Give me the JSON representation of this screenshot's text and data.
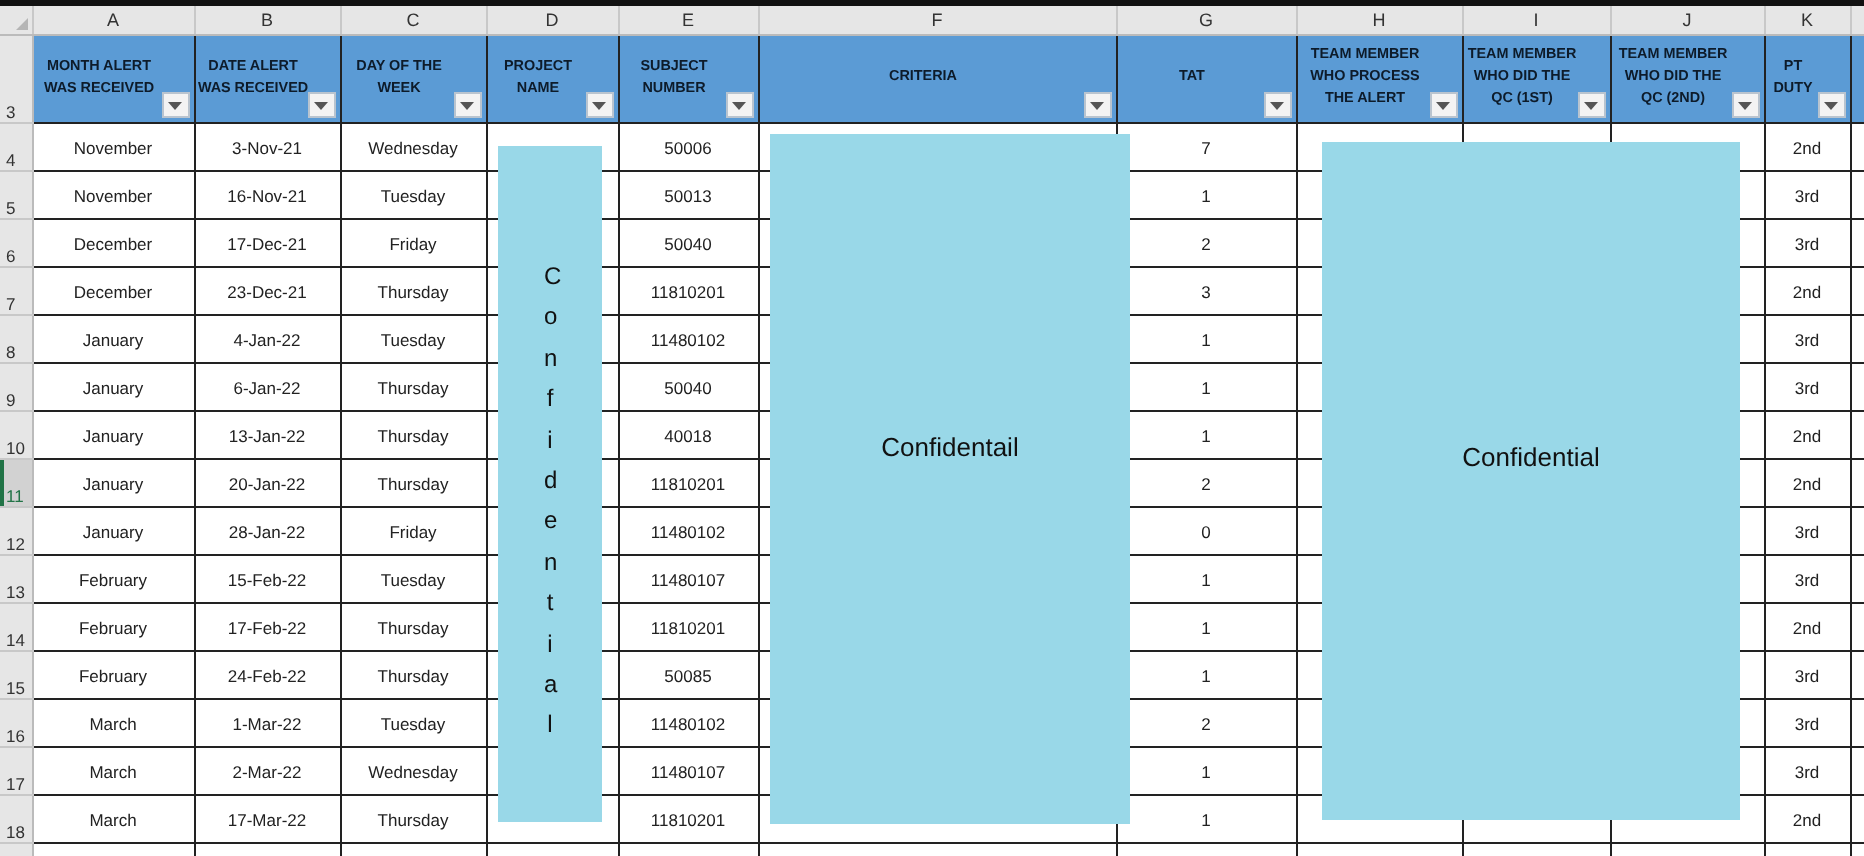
{
  "column_letters": [
    "A",
    "B",
    "C",
    "D",
    "E",
    "F",
    "G",
    "H",
    "I",
    "J",
    "K"
  ],
  "header_row": {
    "number": "3",
    "titles": [
      "MONTH ALERT WAS RECEIVED",
      "DATE ALERT WAS RECEIVED",
      "DAY OF THE WEEK",
      "PROJECT NAME",
      "SUBJECT NUMBER",
      "CRITERIA",
      "TAT",
      "TEAM MEMBER WHO PROCESS THE ALERT",
      "TEAM MEMBER WHO DID THE QC (1ST)",
      "TEAM MEMBER WHO DID THE QC (2ND)",
      "PT DUTY"
    ]
  },
  "rows": [
    {
      "number": "4",
      "month": "November",
      "date": "3-Nov-21",
      "day": "Wednesday",
      "subject": "50006",
      "tat": "7",
      "duty": "2nd",
      "selected": false
    },
    {
      "number": "5",
      "month": "November",
      "date": "16-Nov-21",
      "day": "Tuesday",
      "subject": "50013",
      "tat": "1",
      "duty": "3rd",
      "selected": false
    },
    {
      "number": "6",
      "month": "December",
      "date": "17-Dec-21",
      "day": "Friday",
      "subject": "50040",
      "tat": "2",
      "duty": "3rd",
      "selected": false
    },
    {
      "number": "7",
      "month": "December",
      "date": "23-Dec-21",
      "day": "Thursday",
      "subject": "11810201",
      "tat": "3",
      "duty": "2nd",
      "selected": false
    },
    {
      "number": "8",
      "month": "January",
      "date": "4-Jan-22",
      "day": "Tuesday",
      "subject": "11480102",
      "tat": "1",
      "duty": "3rd",
      "selected": false
    },
    {
      "number": "9",
      "month": "January",
      "date": "6-Jan-22",
      "day": "Thursday",
      "subject": "50040",
      "tat": "1",
      "duty": "3rd",
      "selected": false
    },
    {
      "number": "10",
      "month": "January",
      "date": "13-Jan-22",
      "day": "Thursday",
      "subject": "40018",
      "tat": "1",
      "duty": "2nd",
      "selected": false
    },
    {
      "number": "11",
      "month": "January",
      "date": "20-Jan-22",
      "day": "Thursday",
      "subject": "11810201",
      "tat": "2",
      "duty": "2nd",
      "selected": true
    },
    {
      "number": "12",
      "month": "January",
      "date": "28-Jan-22",
      "day": "Friday",
      "subject": "11480102",
      "tat": "0",
      "duty": "3rd",
      "selected": false
    },
    {
      "number": "13",
      "month": "February",
      "date": "15-Feb-22",
      "day": "Tuesday",
      "subject": "11480107",
      "tat": "1",
      "duty": "3rd",
      "selected": false
    },
    {
      "number": "14",
      "month": "February",
      "date": "17-Feb-22",
      "day": "Thursday",
      "subject": "11810201",
      "tat": "1",
      "duty": "2nd",
      "selected": false
    },
    {
      "number": "15",
      "month": "February",
      "date": "24-Feb-22",
      "day": "Thursday",
      "subject": "50085",
      "tat": "1",
      "duty": "3rd",
      "selected": false
    },
    {
      "number": "16",
      "month": "March",
      "date": "1-Mar-22",
      "day": "Tuesday",
      "subject": "11480102",
      "tat": "2",
      "duty": "3rd",
      "selected": false
    },
    {
      "number": "17",
      "month": "March",
      "date": "2-Mar-22",
      "day": "Wednesday",
      "subject": "11480107",
      "tat": "1",
      "duty": "3rd",
      "selected": false
    },
    {
      "number": "18",
      "month": "March",
      "date": "17-Mar-22",
      "day": "Thursday",
      "subject": "11810201",
      "tat": "1",
      "duty": "2nd",
      "selected": false
    }
  ],
  "redaction_boxes": [
    {
      "kind": "vertical",
      "text": "Confidential"
    },
    {
      "kind": "horizontal",
      "text": "Confidentail"
    },
    {
      "kind": "horizontal",
      "text": "Confidential"
    }
  ]
}
